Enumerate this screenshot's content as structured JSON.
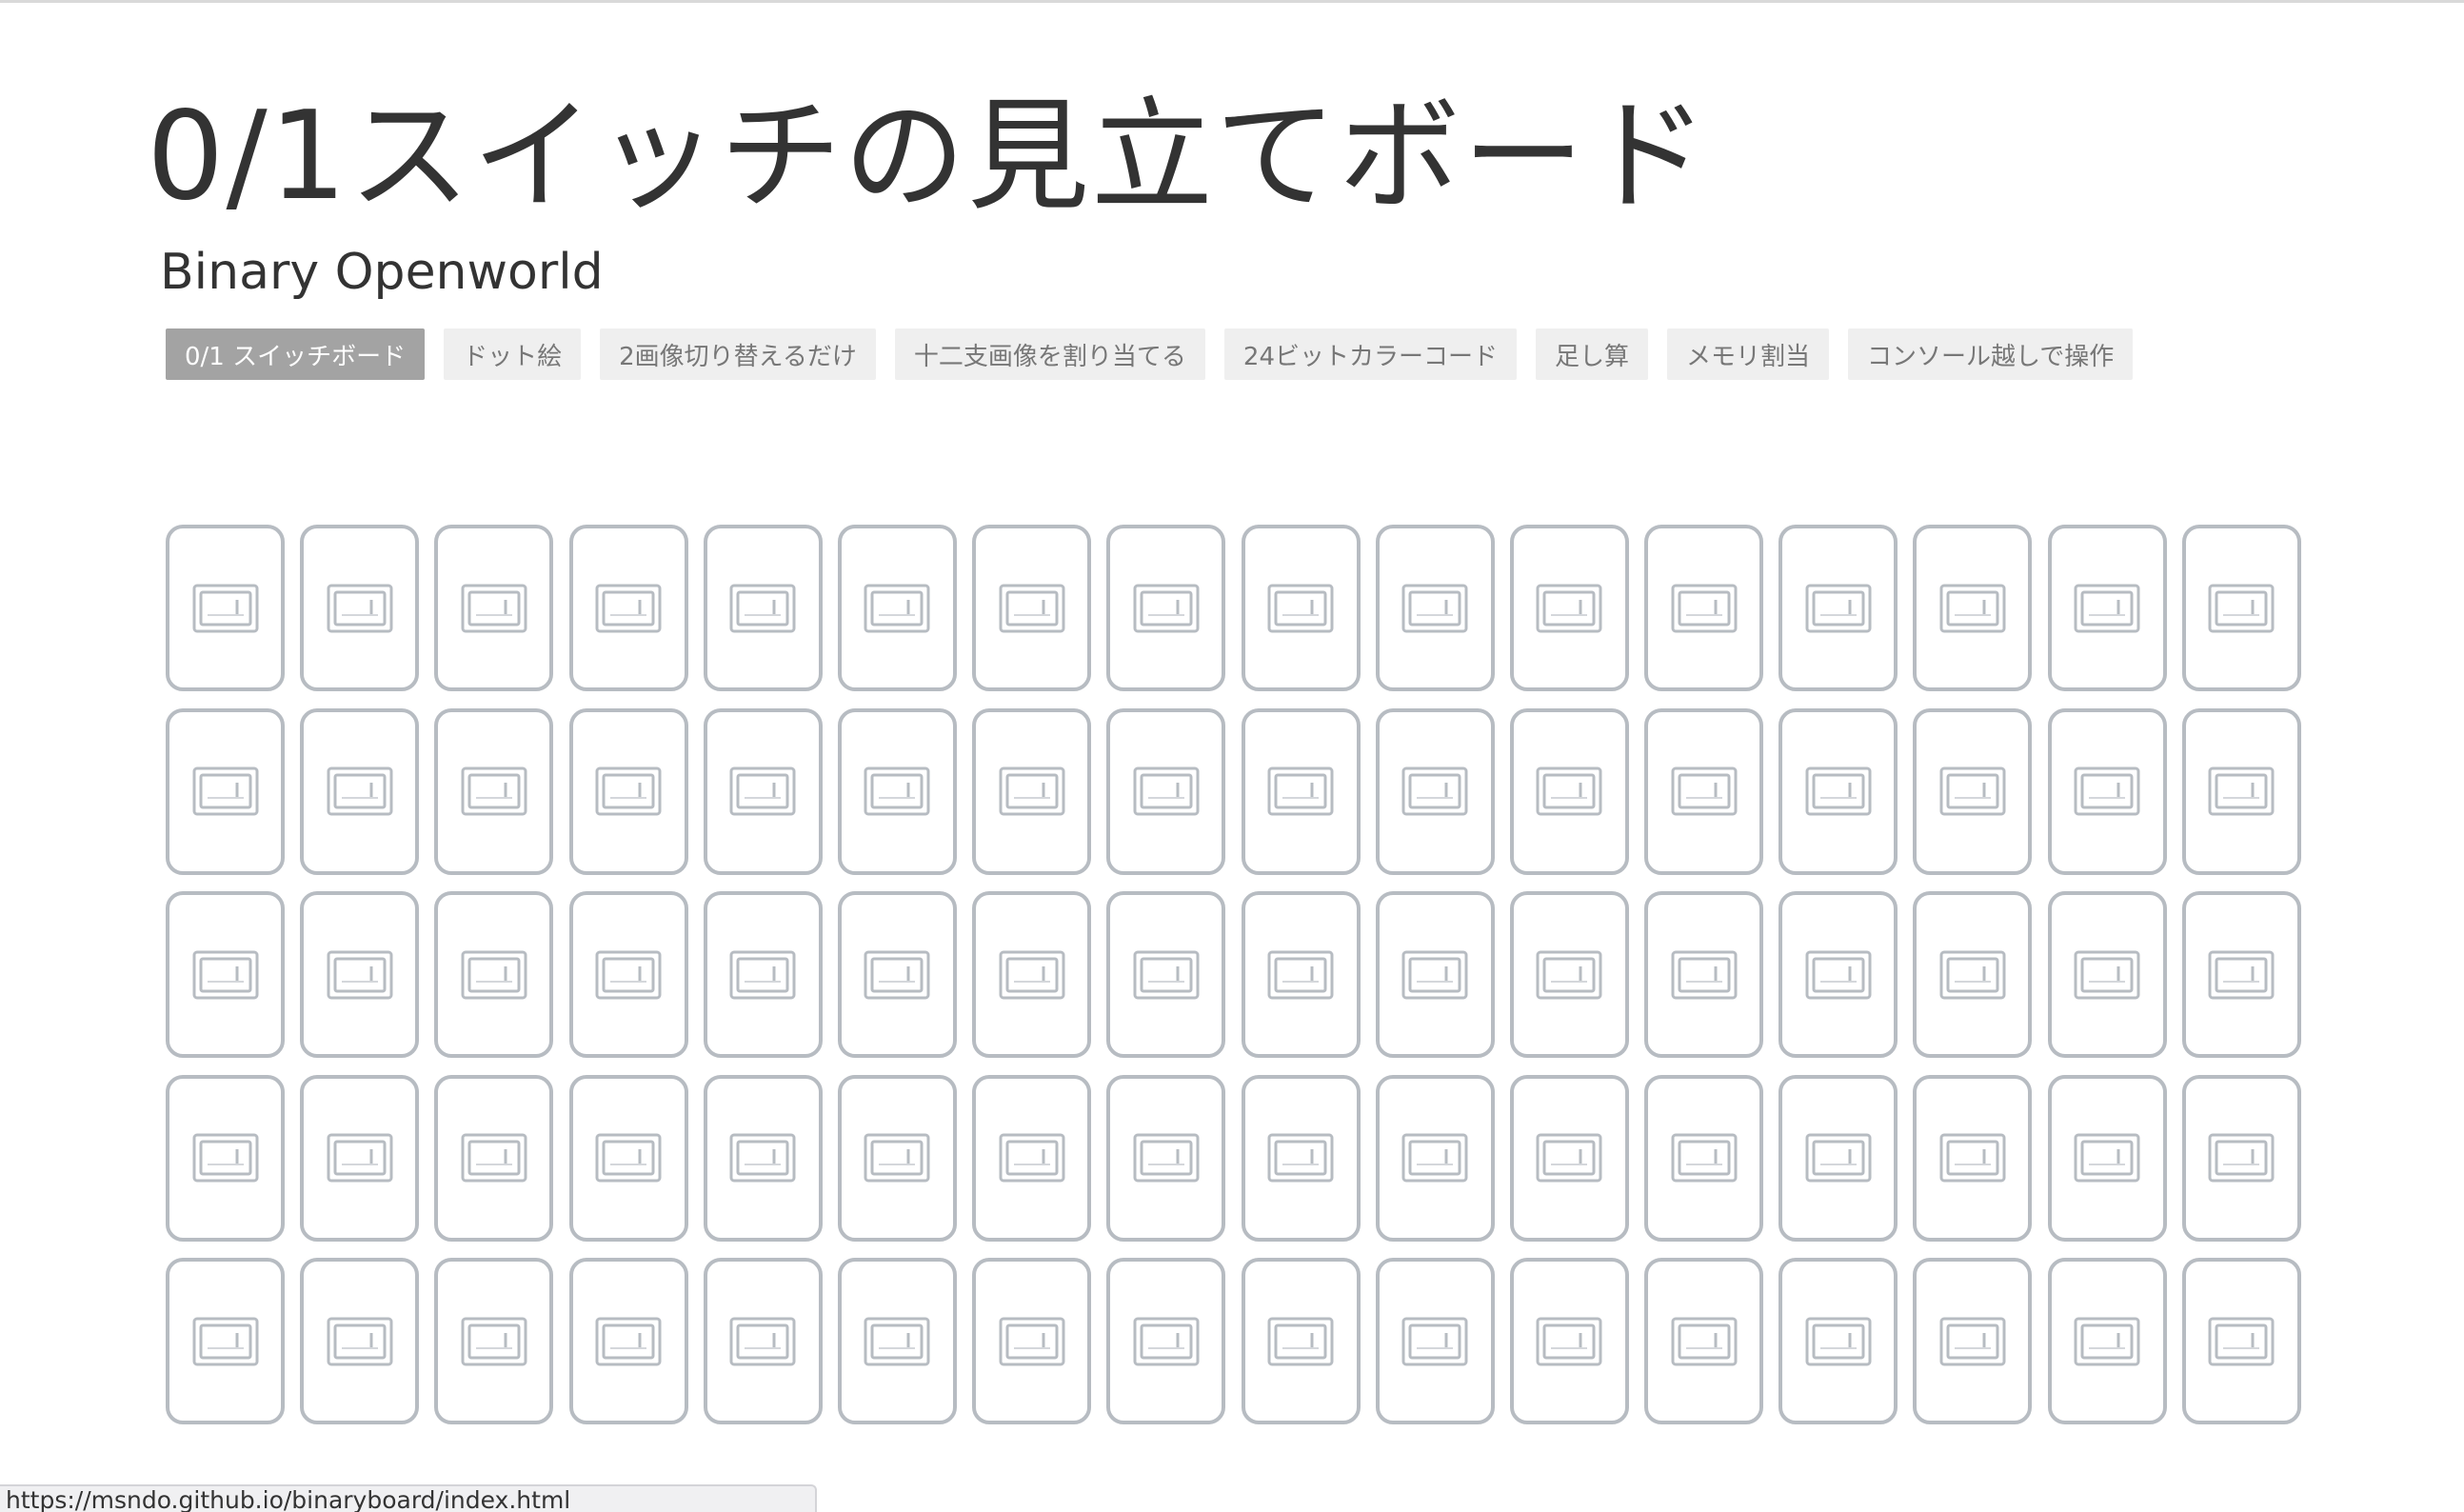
{
  "header": {
    "title": "0/1スイッチの見立てボード",
    "subtitle": "Binary Openworld"
  },
  "tabs": [
    {
      "label": "0/1 スイッチボード",
      "active": true
    },
    {
      "label": "ドット絵",
      "active": false
    },
    {
      "label": "2画像切り替えるだけ",
      "active": false
    },
    {
      "label": "十二支画像を割り当てる",
      "active": false
    },
    {
      "label": "24ビットカラーコード",
      "active": false
    },
    {
      "label": "足し算",
      "active": false
    },
    {
      "label": "メモリ割当",
      "active": false
    },
    {
      "label": "コンソール越しで操作",
      "active": false
    }
  ],
  "board": {
    "rows": 5,
    "columns": 16,
    "switch_state": "0",
    "switch_icon": "toggle-switch-icon"
  },
  "status_bar": {
    "url": "https://msndo.github.io/binaryboard/index.html"
  },
  "colors": {
    "tab_active_bg": "#a3a3a3",
    "tab_bg": "#efefef",
    "card_border": "#b7bcc2"
  }
}
